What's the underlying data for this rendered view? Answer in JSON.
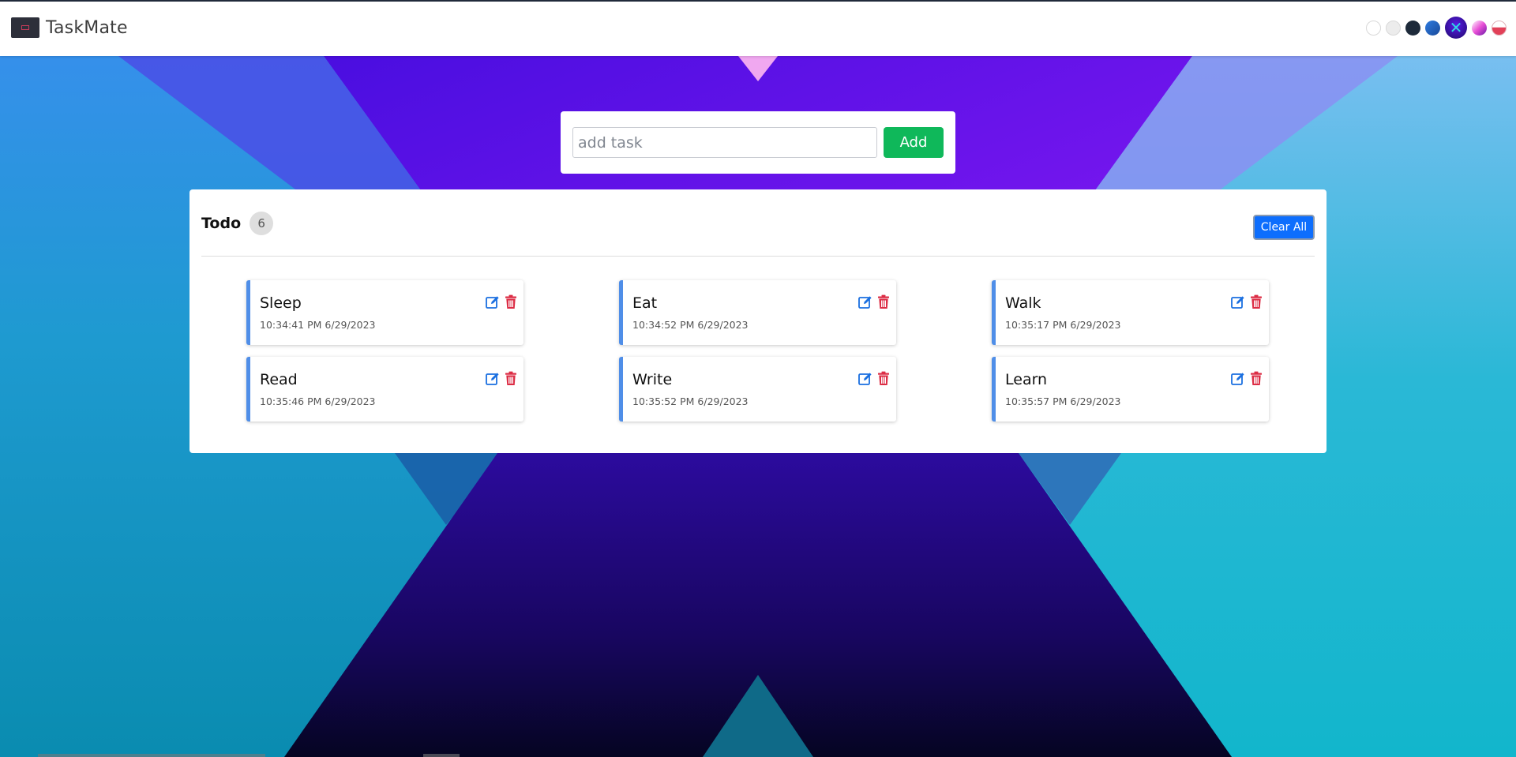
{
  "app": {
    "title": "TaskMate"
  },
  "themes": [
    {
      "name": "light"
    },
    {
      "name": "grey"
    },
    {
      "name": "dark"
    },
    {
      "name": "blue"
    },
    {
      "name": "x-theme"
    },
    {
      "name": "pink"
    },
    {
      "name": "red"
    }
  ],
  "add_task": {
    "placeholder": "add task",
    "value": "",
    "button_label": "Add"
  },
  "todo": {
    "title": "Todo",
    "count": "6",
    "clear_label": "Clear All",
    "tasks": [
      {
        "name": "Sleep",
        "time": "10:34:41 PM 6/29/2023"
      },
      {
        "name": "Eat",
        "time": "10:34:52 PM 6/29/2023"
      },
      {
        "name": "Walk",
        "time": "10:35:17 PM 6/29/2023"
      },
      {
        "name": "Read",
        "time": "10:35:46 PM 6/29/2023"
      },
      {
        "name": "Write",
        "time": "10:35:52 PM 6/29/2023"
      },
      {
        "name": "Learn",
        "time": "10:35:57 PM 6/29/2023"
      }
    ]
  },
  "colors": {
    "accent_blue": "#0d6efd",
    "add_green": "#0fb85a",
    "edit_blue": "#1a6fe0",
    "delete_red": "#dc2d45",
    "card_border": "#4f8ee8"
  },
  "icons": {
    "edit": "edit-icon",
    "delete": "trash-icon"
  }
}
